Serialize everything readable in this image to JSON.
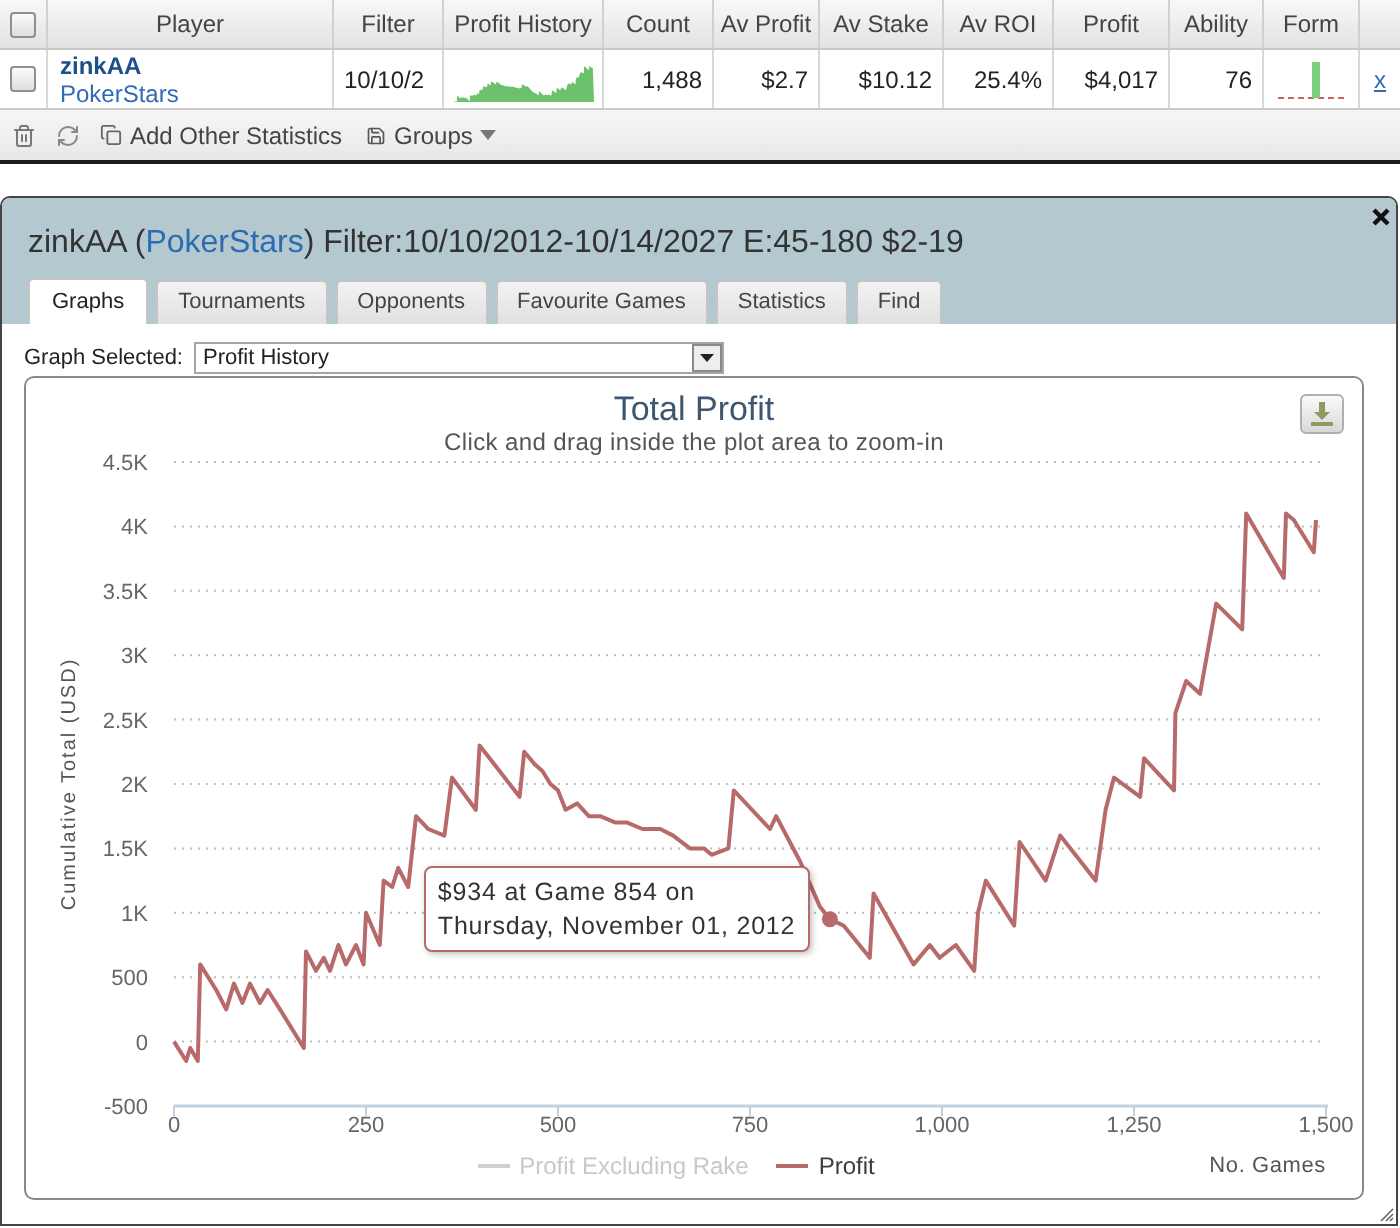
{
  "table": {
    "header_checkbox": {
      "checked": false
    },
    "columns": [
      "Player",
      "Filter",
      "Profit History",
      "Count",
      "Av Profit",
      "Av Stake",
      "Av ROI",
      "Profit",
      "Ability",
      "Form"
    ],
    "rows": [
      {
        "checked": false,
        "player": "zinkAA",
        "site": "PokerStars",
        "filter": "10/10/2",
        "count": "1,488",
        "av_profit": "$2.7",
        "av_stake": "$10.12",
        "av_roi": "25.4%",
        "profit": "$4,017",
        "ability": "76",
        "remove": "x"
      }
    ]
  },
  "toolbar": {
    "buttons": [
      {
        "kind": "delete"
      },
      {
        "kind": "refresh"
      },
      {
        "kind": "add",
        "label": "Add Other Statistics"
      },
      {
        "kind": "menu",
        "label": "Groups"
      }
    ]
  },
  "dialog": {
    "title": {
      "prefix": "zinkAA (",
      "link": "PokerStars",
      "suffix": ") Filter:10/10/2012-10/14/2027 E:45-180 $2-19"
    },
    "tabs": [
      {
        "label": "Graphs",
        "selected": true
      },
      {
        "label": "Tournaments",
        "selected": false
      },
      {
        "label": "Opponents",
        "selected": false
      },
      {
        "label": "Favourite Games",
        "selected": false
      },
      {
        "label": "Statistics",
        "selected": false
      },
      {
        "label": "Find",
        "selected": false
      }
    ],
    "graph_select": {
      "label": "Graph Selected:",
      "value": "Profit History"
    },
    "graph": {
      "subtitle": "Click and drag inside the plot area to zoom-in",
      "legend": [
        {
          "label": "Profit Excluding Rake",
          "visible": false
        }
      ],
      "chart_data": {
        "type": "line",
        "title": "Total Profit",
        "xlabel": "No. Games",
        "ylabel": "Cumulative Total (USD)",
        "grid": true,
        "xlim": [
          0,
          1500
        ],
        "ylim": [
          -500,
          4500
        ],
        "xticks": [
          {
            "value": 0,
            "label": "0"
          },
          {
            "value": 250,
            "label": "250"
          },
          {
            "value": 500,
            "label": "500"
          },
          {
            "value": 750,
            "label": "750"
          },
          {
            "value": 1000,
            "label": "1,000"
          },
          {
            "value": 1250,
            "label": "1,250"
          },
          {
            "value": 1500,
            "label": "1,500"
          }
        ],
        "yticks": [
          {
            "value": -500,
            "label": "-500"
          },
          {
            "value": 0,
            "label": "0"
          },
          {
            "value": 500,
            "label": "500"
          },
          {
            "value": 1000,
            "label": "1K"
          },
          {
            "value": 1500,
            "label": "1.5K"
          },
          {
            "value": 2000,
            "label": "2K"
          },
          {
            "value": 2500,
            "label": "2.5K"
          },
          {
            "value": 3000,
            "label": "3K"
          },
          {
            "value": 3500,
            "label": "3.5K"
          },
          {
            "value": 4000,
            "label": "4K"
          },
          {
            "value": 4500,
            "label": "4.5K"
          }
        ],
        "x": [
          0,
          16,
          21,
          31,
          34,
          55,
          68,
          78,
          89,
          99,
          112,
          122,
          138,
          169,
          172,
          185,
          195,
          203,
          214,
          224,
          237,
          247,
          250,
          268,
          273,
          284,
          292,
          305,
          315,
          331,
          352,
          362,
          393,
          398,
          450,
          456,
          470,
          480,
          490,
          500,
          510,
          525,
          540,
          555,
          575,
          590,
          610,
          633,
          650,
          672,
          690,
          700,
          722,
          729,
          776,
          784,
          815,
          841,
          854,
          872,
          906,
          911,
          963,
          984,
          997,
          1018,
          1042,
          1047,
          1057,
          1094,
          1101,
          1135,
          1154,
          1200,
          1213,
          1224,
          1258,
          1263,
          1302,
          1304,
          1318,
          1336,
          1357,
          1391,
          1396,
          1445,
          1448,
          1458,
          1484,
          1487
        ],
        "series": [
          {
            "name": "Profit",
            "color": "#b86a6a",
            "values": [
              0,
              -150,
              -50,
              -150,
              600,
              400,
              250,
              450,
              300,
              450,
              300,
              400,
              250,
              -50,
              700,
              550,
              650,
              550,
              750,
              600,
              750,
              600,
              1000,
              750,
              1250,
              1200,
              1350,
              1200,
              1750,
              1650,
              1600,
              2050,
              1800,
              2300,
              1900,
              2250,
              2150,
              2100,
              2000,
              1950,
              1800,
              1850,
              1750,
              1750,
              1700,
              1700,
              1650,
              1650,
              1600,
              1500,
              1500,
              1450,
              1500,
              1950,
              1650,
              1750,
              1400,
              1050,
              950,
              900,
              650,
              1150,
              600,
              750,
              650,
              750,
              550,
              1000,
              1250,
              900,
              1550,
              1250,
              1600,
              1250,
              1800,
              2050,
              1900,
              2200,
              1950,
              2550,
              2800,
              2700,
              3400,
              3200,
              4100,
              3600,
              4100,
              4050,
              3800,
              4050
            ]
          }
        ],
        "annotations": [
          {
            "x": 854,
            "y": 950,
            "text": "$934 at Game 854 on\nThursday, November 01, 2012"
          }
        ]
      }
    }
  }
}
